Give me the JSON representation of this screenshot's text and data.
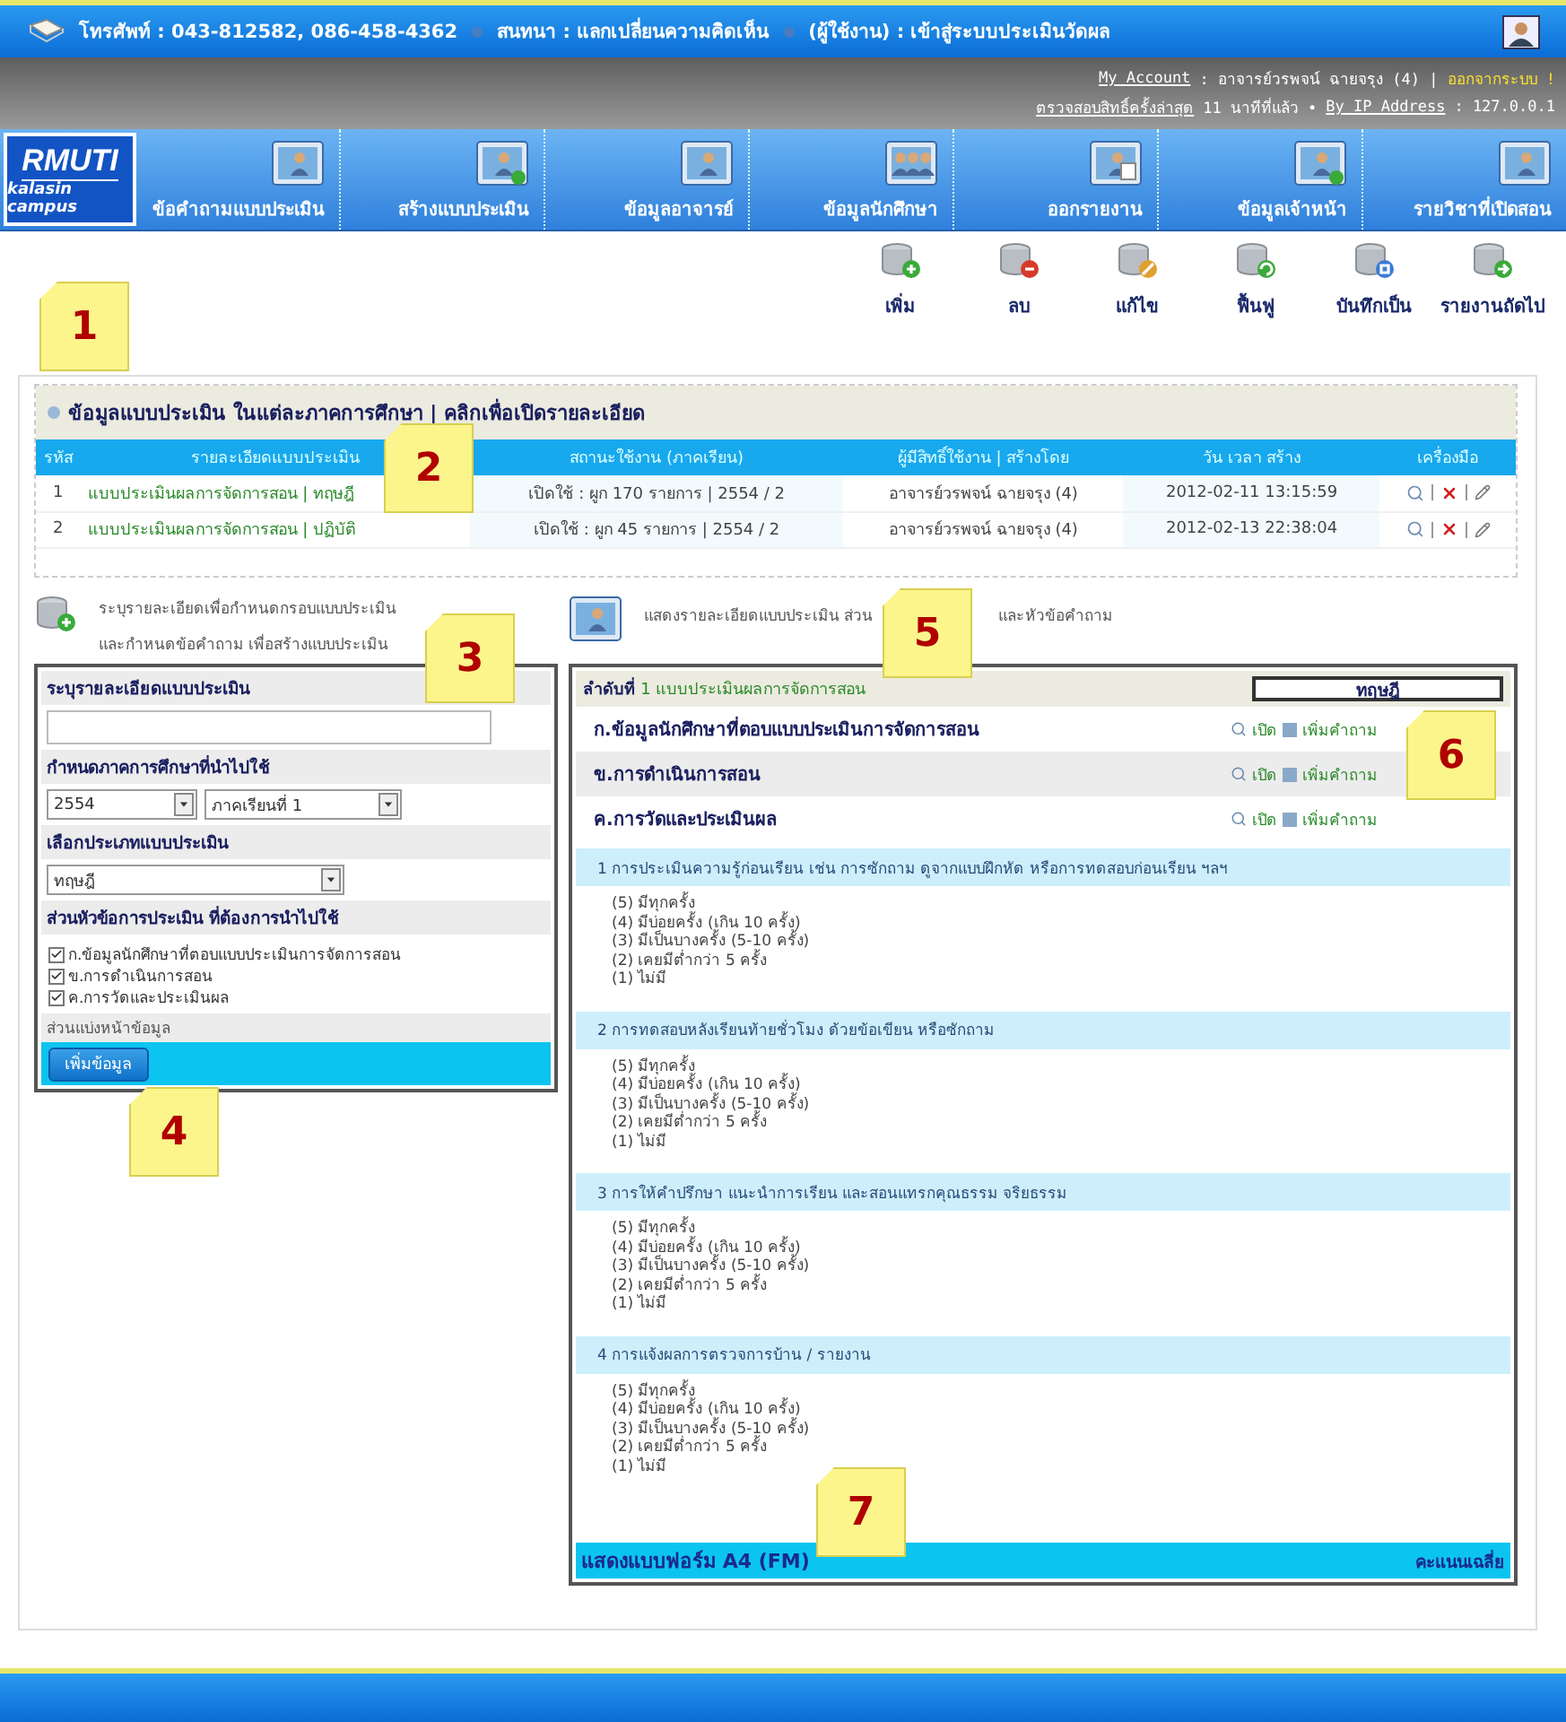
{
  "top_bar": {
    "phone": "โทรศัพท์ : 043-812582, 086-458-4362",
    "chat": "สนทนา : แลกเปลี่ยนความคิดเห็น",
    "user": "(ผู้ใช้งาน) : เข้าสู่ระบบประเมินวัดผล"
  },
  "account": {
    "my_account": "My Account",
    "name": ": อาจารย์วรพจน์ ฉายจรุง (4) |",
    "logout": "ออกจากระบบ !",
    "last_check": "ตรวจสอบสิทธิ์ครั้งล่าสุด",
    "ago": "11 นาทีที่แล้ว •",
    "ip_label": "By IP Address",
    "ip": ": 127.0.0.1"
  },
  "logo": {
    "title": "RMUTI",
    "subtitle": "kalasin campus"
  },
  "nav": [
    {
      "label": "ข้อคำถามแบบประเมิน",
      "kind": "form"
    },
    {
      "label": "สร้างแบบประเมิน",
      "kind": "add"
    },
    {
      "label": "ข้อมูลอาจารย์",
      "kind": "person"
    },
    {
      "label": "ข้อมูลนักศึกษา",
      "kind": "group"
    },
    {
      "label": "ออกรายงาน",
      "kind": "report"
    },
    {
      "label": "ข้อมูลเจ้าหน้า",
      "kind": "add"
    },
    {
      "label": "รายวิชาที่เปิดสอน",
      "kind": "form"
    }
  ],
  "toolbar": [
    {
      "label": "เพิ่ม",
      "kind": "add"
    },
    {
      "label": "ลบ",
      "kind": "delete"
    },
    {
      "label": "แก้ไข",
      "kind": "edit"
    },
    {
      "label": "ฟื้นฟู",
      "kind": "restore"
    },
    {
      "label": "บันทึกเป็น",
      "kind": "save"
    },
    {
      "label": "รายงานถัดไป",
      "kind": "next"
    }
  ],
  "section": {
    "title": "ข้อมูลแบบประเมิน ในแต่ละภาคการศึกษา | คลิกเพื่อเปิดรายละเอียด"
  },
  "table": {
    "columns": [
      "รหัส",
      "รายละเอียดแบบประเมิน",
      "สถานะใช้งาน (ภาคเรียน)",
      "ผู้มีสิทธิ์ใช้งาน | สร้างโดย",
      "วัน เวลา สร้าง",
      "เครื่องมือ"
    ],
    "rows": [
      {
        "id": "1",
        "detail": "แบบประเมินผลการจัดการสอน | ทฤษฎี",
        "status": "เปิดใช้ : ผูก 170 รายการ | 2554 / 2",
        "owner": "อาจารย์วรพจน์ ฉายจรุง (4)",
        "created": "2012-02-11 13:15:59"
      },
      {
        "id": "2",
        "detail": "แบบประเมินผลการจัดการสอน | ปฏิบัติ",
        "status": "เปิดใช้ : ผูก 45 รายการ | 2554 / 2",
        "owner": "อาจารย์วรพจน์ ฉายจรุง (4)",
        "created": "2012-02-13 22:38:04"
      }
    ]
  },
  "create_intro": [
    "ระบุรายละเอียดเพื่อกำหนดกรอบแบบประเมิน",
    "และกำหนดข้อคำถาม เพื่อสร้างแบบประเมิน"
  ],
  "form": {
    "detail_label": "ระบุรายละเอียดแบบประเมิน",
    "term_label": "กำหนดภาคการศึกษาที่นำไปใช้",
    "year": "2554",
    "term": "ภาคเรียนที่ 1",
    "type_label": "เลือกประเภทแบบประเมิน",
    "type": "ทฤษฎี",
    "parts_label": "ส่วนหัวข้อการประเมิน ที่ต้องการนำไปใช้",
    "parts": [
      {
        "label": "ก.ข้อมูลนักศึกษาที่ตอบแบบประเมินการจัดการสอน",
        "checked": true
      },
      {
        "label": "ข.การดำเนินการสอน",
        "checked": true
      },
      {
        "label": "ค.การวัดและประเมินผล",
        "checked": true
      }
    ],
    "paging_label": "ส่วนแบ่งหน้าข้อมูล",
    "submit": "เพิ่มข้อมูล"
  },
  "detail_intro": [
    "แสดงรายละเอียดแบบประเมิน ส่วน",
    "และหัวข้อคำถาม"
  ],
  "detail": {
    "order_label": "ลำดับที่",
    "order_text": "1 แบบประเมินผลการจัดการสอน",
    "type": "ทฤษฎี",
    "sections": [
      {
        "title": "ก.ข้อมูลนักศึกษาที่ตอบแบบประเมินการจัดการสอน",
        "open": "เปิด",
        "add": "เพิ่มคำถาม"
      },
      {
        "title": "ข.การดำเนินการสอน",
        "open": "เปิด",
        "add": "เพิ่มคำถาม"
      },
      {
        "title": "ค.การวัดและประเมินผล",
        "open": "เปิด",
        "add": "เพิ่มคำถาม"
      }
    ],
    "questions": [
      {
        "text": "1 การประเมินความรู้ก่อนเรียน เช่น การซักถาม ดูจากแบบฝึกหัด หรือการทดสอบก่อนเรียน ฯลฯ",
        "options": [
          "(5) มีทุกครั้ง",
          "(4) มีบ่อยครั้ง (เกิน 10 ครั้ง)",
          "(3) มีเป็นบางครั้ง (5-10 ครั้ง)",
          "(2) เคยมีต่ำกว่า 5 ครั้ง",
          "(1) ไม่มี"
        ]
      },
      {
        "text": "2 การทดสอบหลังเรียนท้ายชั่วโมง ด้วยข้อเขียน หรือซักถาม",
        "options": [
          "(5) มีทุกครั้ง",
          "(4) มีบ่อยครั้ง (เกิน 10 ครั้ง)",
          "(3) มีเป็นบางครั้ง (5-10 ครั้ง)",
          "(2) เคยมีต่ำกว่า 5 ครั้ง",
          "(1) ไม่มี"
        ]
      },
      {
        "text": "3 การให้คำปรึกษา แนะนำการเรียน และสอนแทรกคุณธรรม จริยธรรม",
        "options": [
          "(5) มีทุกครั้ง",
          "(4) มีบ่อยครั้ง (เกิน 10 ครั้ง)",
          "(3) มีเป็นบางครั้ง (5-10 ครั้ง)",
          "(2) เคยมีต่ำกว่า 5 ครั้ง",
          "(1) ไม่มี"
        ]
      },
      {
        "text": "4 การแจ้งผลการตรวจการบ้าน / รายงาน",
        "options": [
          "(5) มีทุกครั้ง",
          "(4) มีบ่อยครั้ง (เกิน 10 ครั้ง)",
          "(3) มีเป็นบางครั้ง (5-10 ครั้ง)",
          "(2) เคยมีต่ำกว่า 5 ครั้ง",
          "(1) ไม่มี"
        ]
      }
    ],
    "footer_left": "แสดงแบบฟอร์ม A4 (FM)",
    "footer_right": "คะแนนเฉลี่ย"
  },
  "notes": [
    "1",
    "2",
    "3",
    "4",
    "5",
    "6",
    "7"
  ]
}
